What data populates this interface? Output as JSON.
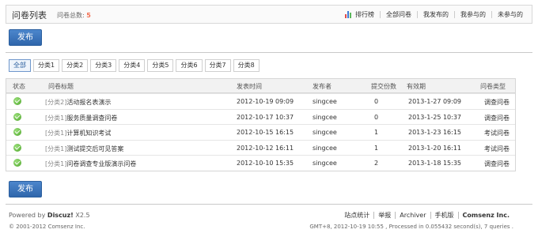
{
  "header": {
    "title": "问卷列表",
    "count_label": "问卷总数:",
    "count_value": "5",
    "nav": [
      "排行榜",
      "全部问卷",
      "我发布的",
      "我参与的",
      "未参与的"
    ]
  },
  "publish_label": "发布",
  "filters": [
    "全部",
    "分类1",
    "分类2",
    "分类3",
    "分类4",
    "分类5",
    "分类6",
    "分类7",
    "分类8"
  ],
  "table": {
    "columns": [
      "状态",
      "问卷标题",
      "发表时间",
      "发布者",
      "提交份数",
      "有效期",
      "问卷类型"
    ],
    "rows": [
      {
        "category": "[分类2]",
        "title": "活动报名表演示",
        "posted": "2012-10-19 09:09",
        "author": "singcee",
        "submissions": "0",
        "expires": "2013-1-27 09:09",
        "type": "调查问卷"
      },
      {
        "category": "[分类1]",
        "title": "服务质量调查问卷",
        "posted": "2012-10-17 10:37",
        "author": "singcee",
        "submissions": "0",
        "expires": "2013-1-25 10:37",
        "type": "调查问卷"
      },
      {
        "category": "[分类1]",
        "title": "计算机知识考试",
        "posted": "2012-10-15 16:15",
        "author": "singcee",
        "submissions": "1",
        "expires": "2013-1-23 16:15",
        "type": "考试问卷"
      },
      {
        "category": "[分类1]",
        "title": "测试提交后可见答案",
        "posted": "2012-10-12 16:11",
        "author": "singcee",
        "submissions": "1",
        "expires": "2013-1-20 16:11",
        "type": "考试问卷"
      },
      {
        "category": "[分类1]",
        "title": "问卷调查专业版演示问卷",
        "posted": "2012-10-10 15:35",
        "author": "singcee",
        "submissions": "2",
        "expires": "2013-1-18 15:35",
        "type": "调查问卷"
      }
    ]
  },
  "footer": {
    "powered_prefix": "Powered by",
    "powered_product": "Discuz!",
    "powered_version": "X2.5",
    "copyright": "© 2001-2012 Comsenz Inc.",
    "links": [
      "站点统计",
      "举报",
      "Archiver",
      "手机版",
      "Comsenz Inc."
    ],
    "gmt": "GMT+8, 2012-10-19 10:55 , Processed in 0.055432 second(s), 7 queries ."
  },
  "colors": {
    "accent": "#3b73b9",
    "count": "#f26c4f",
    "status_ok": "#4da52a"
  }
}
